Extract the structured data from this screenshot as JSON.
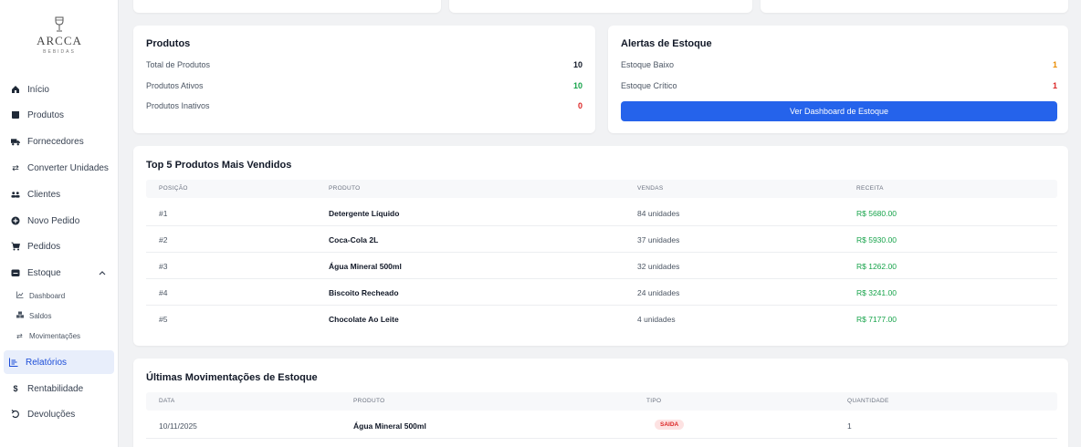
{
  "brand": {
    "name": "ARCCA",
    "sub": "BEBIDAS"
  },
  "sidebar": {
    "items": [
      {
        "label": "Início",
        "icon": "home-icon"
      },
      {
        "label": "Produtos",
        "icon": "box-icon"
      },
      {
        "label": "Fornecedores",
        "icon": "truck-icon"
      },
      {
        "label": "Converter Unidades",
        "icon": "swap-icon"
      },
      {
        "label": "Clientes",
        "icon": "users-icon"
      },
      {
        "label": "Novo Pedido",
        "icon": "plus-circle-icon"
      },
      {
        "label": "Pedidos",
        "icon": "cart-icon"
      },
      {
        "label": "Estoque",
        "icon": "warehouse-icon"
      }
    ],
    "estoque_sub": [
      {
        "label": "Dashboard",
        "icon": "chart-icon"
      },
      {
        "label": "Saldos",
        "icon": "boxes-icon"
      },
      {
        "label": "Movimentações",
        "icon": "swap-icon"
      }
    ],
    "bottom_items": [
      {
        "label": "Relatórios",
        "icon": "report-icon",
        "active": true
      },
      {
        "label": "Rentabilidade",
        "icon": "dollar-icon"
      },
      {
        "label": "Devoluções",
        "icon": "undo-icon"
      }
    ]
  },
  "produtos_card": {
    "title": "Produtos",
    "rows": [
      {
        "label": "Total de Produtos",
        "value": "10",
        "color": "#111827"
      },
      {
        "label": "Produtos Ativos",
        "value": "10",
        "color": "#16a34a"
      },
      {
        "label": "Produtos Inativos",
        "value": "0",
        "color": "#dc2626"
      }
    ]
  },
  "alertas_card": {
    "title": "Alertas de Estoque",
    "rows": [
      {
        "label": "Estoque Baixo",
        "value": "1",
        "color": "#ea8c00"
      },
      {
        "label": "Estoque Crítico",
        "value": "1",
        "color": "#dc2626"
      }
    ],
    "button": "Ver Dashboard de Estoque"
  },
  "top5": {
    "title": "Top 5 Produtos Mais Vendidos",
    "headers": [
      "POSIÇÃO",
      "PRODUTO",
      "VENDAS",
      "RECEITA"
    ],
    "rows": [
      {
        "pos": "#1",
        "produto": "Detergente Líquido",
        "vendas": "84 unidades",
        "receita": "R$ 5680.00"
      },
      {
        "pos": "#2",
        "produto": "Coca-Cola 2L",
        "vendas": "37 unidades",
        "receita": "R$ 5930.00"
      },
      {
        "pos": "#3",
        "produto": "Água Mineral 500ml",
        "vendas": "32 unidades",
        "receita": "R$ 1262.00"
      },
      {
        "pos": "#4",
        "produto": "Biscoito Recheado",
        "vendas": "24 unidades",
        "receita": "R$ 3241.00"
      },
      {
        "pos": "#5",
        "produto": "Chocolate Ao Leite",
        "vendas": "4 unidades",
        "receita": "R$ 7177.00"
      }
    ]
  },
  "movimentacoes": {
    "title": "Últimas Movimentações de Estoque",
    "headers": [
      "DATA",
      "PRODUTO",
      "TIPO",
      "QUANTIDADE"
    ],
    "rows": [
      {
        "data": "10/11/2025",
        "produto": "Água Mineral 500ml",
        "tipo": "SAIDA",
        "quantidade": "1"
      }
    ]
  },
  "colors": {
    "accent": "#2563eb",
    "green": "#16a34a",
    "red": "#dc2626",
    "orange": "#ea8c00"
  }
}
